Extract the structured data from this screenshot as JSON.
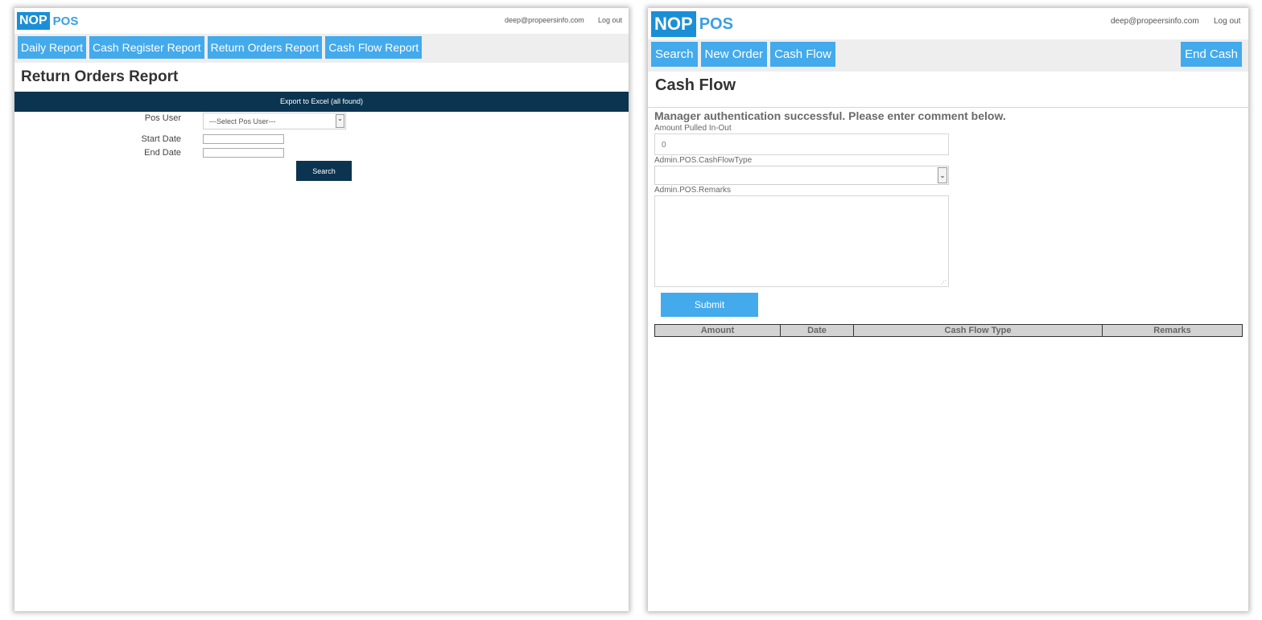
{
  "left": {
    "logo": {
      "nop": "NOP",
      "pos": "POS"
    },
    "user_email": "deep@propeersinfo.com",
    "logout": "Log out",
    "nav": [
      "Daily Report",
      "Cash Register Report",
      "Return Orders Report",
      "Cash Flow Report"
    ],
    "title": "Return Orders Report",
    "export_label": "Export to Excel (all found)",
    "form": {
      "pos_user_label": "Pos User",
      "pos_user_value": "---Select Pos User---",
      "start_date_label": "Start Date",
      "end_date_label": "End Date",
      "search_label": "Search"
    },
    "colors": {
      "nav_button": "#43aaec",
      "dark_bar": "#0b3450"
    }
  },
  "right": {
    "logo": {
      "nop": "NOP",
      "pos": "POS"
    },
    "user_email": "deep@propeersinfo.com",
    "logout": "Log out",
    "nav": [
      "Search",
      "New Order",
      "Cash Flow"
    ],
    "end_cash": "End Cash",
    "title": "Cash Flow",
    "auth_message": "Manager authentication successful. Please enter comment below.",
    "form": {
      "amount_label": "Amount Pulled In-Out",
      "amount_value": "0",
      "type_label": "Admin.POS.CashFlowType",
      "remarks_label": "Admin.POS.Remarks",
      "submit_label": "Submit"
    },
    "table_headers": [
      "Amount",
      "Date",
      "Cash Flow Type",
      "Remarks"
    ]
  }
}
